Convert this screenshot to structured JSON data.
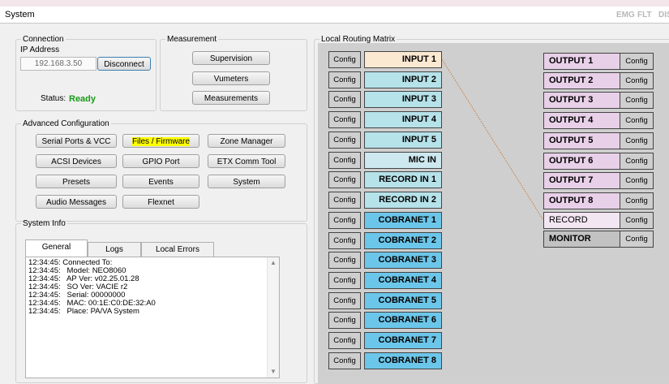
{
  "window": {
    "title": "System"
  },
  "indicators": [
    "EMG",
    "FLT",
    "DIS"
  ],
  "connection": {
    "legend": "Connection",
    "ip_label": "IP Address",
    "ip_value": "192.168.3.50",
    "disconnect_label": "Disconnect",
    "status_label": "Status:",
    "status_value": "Ready",
    "status_color": "#1a9a1a"
  },
  "measurement": {
    "legend": "Measurement",
    "buttons": [
      "Supervision",
      "Vumeters",
      "Measurements"
    ]
  },
  "advanced": {
    "legend": "Advanced Configuration",
    "buttons": [
      "Serial Ports & VCC",
      "Files / Firmware",
      "Zone Manager",
      "ACSI Devices",
      "GPIO Port",
      "ETX Comm Tool",
      "Presets",
      "Events",
      "System",
      "Audio Messages",
      "Flexnet"
    ],
    "highlight_color": "#ffff00"
  },
  "system_info": {
    "legend": "System Info",
    "tabs": [
      "General",
      "Logs",
      "Local Errors"
    ],
    "active_tab": "General",
    "log_lines": [
      "12:34:45: Connected To:",
      "12:34:45:   Model: NEO8060",
      "12:34:45:   AP Ver: v02.25.01.28",
      "12:34:45:   SO Ver: VACIE r2",
      "12:34:45:   Serial: 00000000",
      "12:34:45:   MAC: 00:1E:C0:DE:32:A0",
      "12:34:45:   Place: PA/VA System"
    ]
  },
  "routing": {
    "legend": "Local Routing Matrix",
    "config_label": "Config",
    "inputs": [
      "INPUT 1",
      "INPUT 2",
      "INPUT 3",
      "INPUT 4",
      "INPUT 5",
      "MIC IN",
      "RECORD IN 1",
      "RECORD IN 2",
      "COBRANET 1",
      "COBRANET 2",
      "COBRANET 3",
      "COBRANET 4",
      "COBRANET 5",
      "COBRANET 6",
      "COBRANET 7",
      "COBRANET 8"
    ],
    "outputs": [
      "OUTPUT 1",
      "OUTPUT 2",
      "OUTPUT 3",
      "OUTPUT 4",
      "OUTPUT 5",
      "OUTPUT 6",
      "OUTPUT 7",
      "OUTPUT 8",
      "RECORD",
      "MONITOR"
    ],
    "route": {
      "from": "INPUT 1",
      "to": "RECORD"
    },
    "colors": {
      "input": "#b6e2ea",
      "cobranet": "#6cc6ea",
      "selected_input": "#fce9d2",
      "output": "#e8d0e8",
      "route_line": "#c87a3a"
    }
  }
}
